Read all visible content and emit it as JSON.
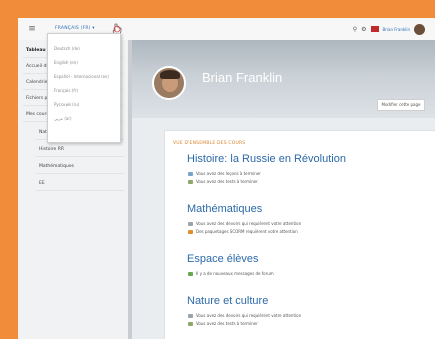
{
  "navbar": {
    "menu_icon": "hamburger-icon",
    "language_label": "FRANÇAIS (FR) ▾",
    "user_name": "Brian Franklin"
  },
  "language_menu": {
    "options": [
      "Deutsch (de)",
      "English (en)",
      "Español - Internacional (es)",
      "Français (fr)",
      "Русский (ru)",
      "عربي (ar)"
    ]
  },
  "sidebar": {
    "items": [
      {
        "label": "Tableau de bord",
        "strong": true
      },
      {
        "label": "Accueil du site",
        "strong": false
      },
      {
        "label": "Calendrier",
        "strong": false
      },
      {
        "label": "Fichiers personnels",
        "strong": false
      },
      {
        "label": "Mes cours",
        "strong": false
      }
    ],
    "sub_items": [
      "Nature/Culture",
      "Histoire RR",
      "Mathématiques",
      "EE"
    ]
  },
  "profile": {
    "name": "Brian Franklin",
    "edit_button": "Modifier cette page"
  },
  "overview": {
    "heading": "VUE D'ENSEMBLE DES COURS",
    "courses": [
      {
        "title": "Histoire: la Russie en Révolution",
        "notices": [
          {
            "icon": "lesson-icon",
            "color": "#7aa3c9",
            "text": "Vous avez des leçons à terminer"
          },
          {
            "icon": "quiz-icon",
            "color": "#8fa86a",
            "text": "Vous avez des tests à terminer"
          }
        ]
      },
      {
        "title": "Mathématiques",
        "notices": [
          {
            "icon": "assignment-icon",
            "color": "#9aa4ad",
            "text": "Vous avez des devoirs qui requièrent votre attention"
          },
          {
            "icon": "scorm-icon",
            "color": "#e0902a",
            "text": "Des paquetages SCORM requièrent votre attention"
          }
        ]
      },
      {
        "title": "Espace élèves",
        "notices": [
          {
            "icon": "forum-icon",
            "color": "#6aa84f",
            "text": "Il y a de nouveaux messages de forum"
          }
        ]
      },
      {
        "title": "Nature et culture",
        "notices": [
          {
            "icon": "assignment-icon",
            "color": "#9aa4ad",
            "text": "Vous avez des devoirs qui requièrent votre attention"
          },
          {
            "icon": "quiz-icon",
            "color": "#8fa86a",
            "text": "Vous avez des tests à terminer"
          }
        ]
      }
    ]
  },
  "colors": {
    "frame": "#f08c3a",
    "link": "#2c6aa8",
    "heading_accent": "#d9822b"
  }
}
